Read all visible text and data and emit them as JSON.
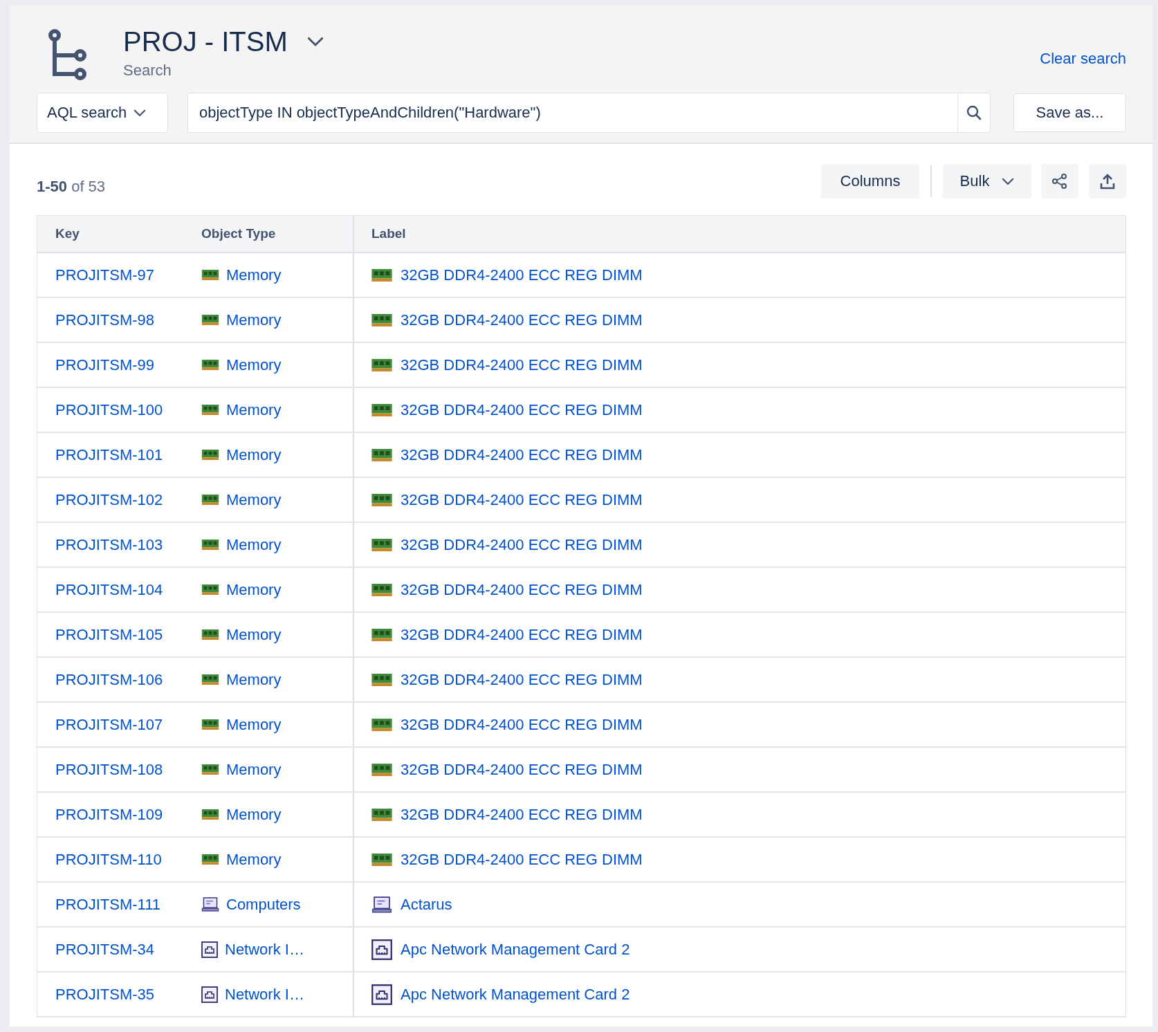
{
  "header": {
    "title": "PROJ - ITSM",
    "subtitle": "Search",
    "clear_link": "Clear search"
  },
  "search": {
    "mode": "AQL search",
    "query": "objectType IN objectTypeAndChildren(\"Hardware\")",
    "save_button": "Save as..."
  },
  "results": {
    "range": "1-50",
    "total_text": "of 53"
  },
  "toolbar": {
    "columns_button": "Columns",
    "bulk_button": "Bulk"
  },
  "table": {
    "columns": [
      "Key",
      "Object Type",
      "Label"
    ],
    "rows": [
      {
        "key": "PROJITSM-97",
        "kind": "memory",
        "object_type": "Memory",
        "label": "32GB DDR4-2400 ECC REG DIMM"
      },
      {
        "key": "PROJITSM-98",
        "kind": "memory",
        "object_type": "Memory",
        "label": "32GB DDR4-2400 ECC REG DIMM"
      },
      {
        "key": "PROJITSM-99",
        "kind": "memory",
        "object_type": "Memory",
        "label": "32GB DDR4-2400 ECC REG DIMM"
      },
      {
        "key": "PROJITSM-100",
        "kind": "memory",
        "object_type": "Memory",
        "label": "32GB DDR4-2400 ECC REG DIMM"
      },
      {
        "key": "PROJITSM-101",
        "kind": "memory",
        "object_type": "Memory",
        "label": "32GB DDR4-2400 ECC REG DIMM"
      },
      {
        "key": "PROJITSM-102",
        "kind": "memory",
        "object_type": "Memory",
        "label": "32GB DDR4-2400 ECC REG DIMM"
      },
      {
        "key": "PROJITSM-103",
        "kind": "memory",
        "object_type": "Memory",
        "label": "32GB DDR4-2400 ECC REG DIMM"
      },
      {
        "key": "PROJITSM-104",
        "kind": "memory",
        "object_type": "Memory",
        "label": "32GB DDR4-2400 ECC REG DIMM"
      },
      {
        "key": "PROJITSM-105",
        "kind": "memory",
        "object_type": "Memory",
        "label": "32GB DDR4-2400 ECC REG DIMM"
      },
      {
        "key": "PROJITSM-106",
        "kind": "memory",
        "object_type": "Memory",
        "label": "32GB DDR4-2400 ECC REG DIMM"
      },
      {
        "key": "PROJITSM-107",
        "kind": "memory",
        "object_type": "Memory",
        "label": "32GB DDR4-2400 ECC REG DIMM"
      },
      {
        "key": "PROJITSM-108",
        "kind": "memory",
        "object_type": "Memory",
        "label": "32GB DDR4-2400 ECC REG DIMM"
      },
      {
        "key": "PROJITSM-109",
        "kind": "memory",
        "object_type": "Memory",
        "label": "32GB DDR4-2400 ECC REG DIMM"
      },
      {
        "key": "PROJITSM-110",
        "kind": "memory",
        "object_type": "Memory",
        "label": "32GB DDR4-2400 ECC REG DIMM"
      },
      {
        "key": "PROJITSM-111",
        "kind": "computer",
        "object_type": "Computers",
        "label": "Actarus"
      },
      {
        "key": "PROJITSM-34",
        "kind": "network",
        "object_type": "Network I…",
        "label": "Apc Network Management Card 2"
      },
      {
        "key": "PROJITSM-35",
        "kind": "network",
        "object_type": "Network I…",
        "label": "Apc Network Management Card 2"
      }
    ]
  }
}
